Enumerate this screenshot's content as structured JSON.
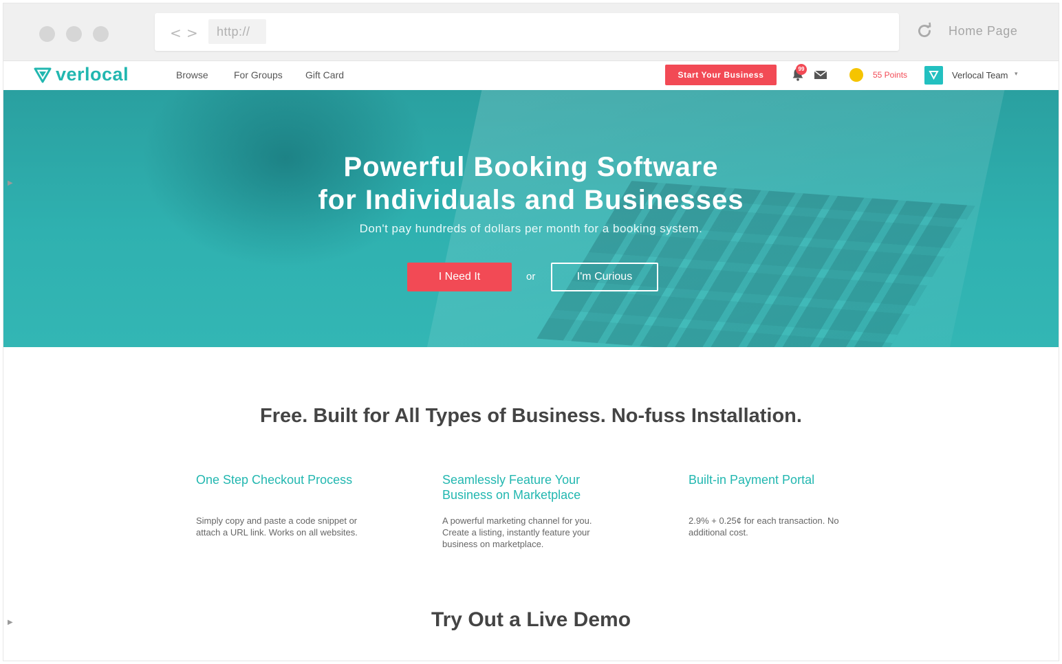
{
  "browser": {
    "url_placeholder": "http://",
    "home_label": "Home Page",
    "back_glyph": "<",
    "forward_glyph": ">"
  },
  "header": {
    "logo_text": "verlocal",
    "menu": [
      "Browse",
      "For Groups",
      "Gift Card"
    ],
    "cta_label": "Start Your Business",
    "notification_count": "99",
    "points_label": "55 Points",
    "user_name": "Verlocal Team"
  },
  "hero": {
    "title_line1": "Powerful Booking Software",
    "title_line2": "for Individuals and Businesses",
    "subtitle": "Don't pay hundreds of dollars per month for a booking system.",
    "primary_button": "I Need It",
    "or_text": "or",
    "secondary_button": "I'm Curious"
  },
  "features": {
    "heading": "Free. Built for All Types of Business. No-fuss Installation.",
    "items": [
      {
        "title": "One Step Checkout Process",
        "desc": "Simply copy and paste a code snippet or attach a URL link. Works on all websites."
      },
      {
        "title": "Seamlessly Feature Your Business on Marketplace",
        "desc": "A powerful marketing channel for you. Create a listing, instantly feature your business on marketplace."
      },
      {
        "title": "Built-in Payment Portal",
        "desc": "2.9% + 0.25¢ for each transaction. No additional cost."
      }
    ]
  },
  "demo": {
    "heading": "Try Out a Live Demo"
  },
  "colors": {
    "brand_teal": "#22b7b0",
    "accent_red": "#f24a55",
    "hero_teal": "#2fb1b0"
  },
  "icons": [
    "reload-icon",
    "bell-icon",
    "mail-icon",
    "coin-icon",
    "logo-icon",
    "avatar-icon",
    "caret-down-icon"
  ]
}
